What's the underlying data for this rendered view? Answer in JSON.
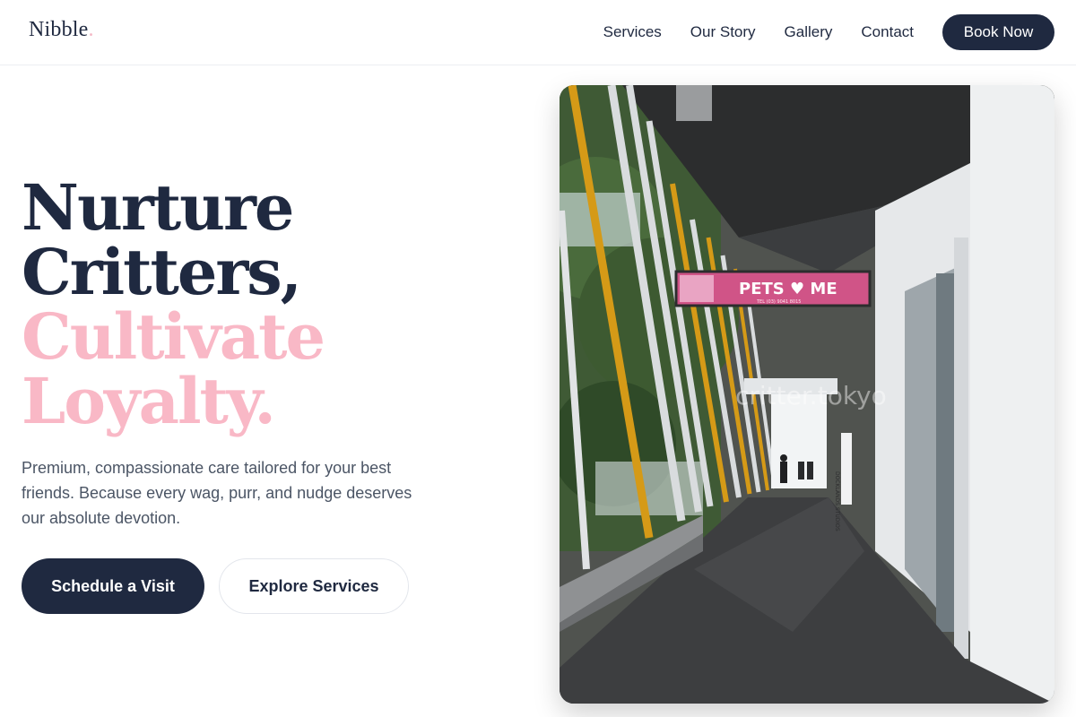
{
  "header": {
    "logo": "Nibble",
    "logo_dot": ".",
    "nav": [
      "Services",
      "Our Story",
      "Gallery",
      "Contact"
    ],
    "cta": "Book Now"
  },
  "hero": {
    "headline": [
      "Nurture",
      "Critters,",
      "Cultivate",
      "Loyalty."
    ],
    "subtitle": "Premium, compassionate care tailored for your best friends. Because every wag, purr, and nudge deserves our absolute devotion.",
    "primary_button": "Schedule a Visit",
    "secondary_button": "Explore Services",
    "image": {
      "sign_text": "PETS ♥ ME",
      "sign_phone": "TEL (03) 9041 8015",
      "side_sign": "DOCKLANDS STUDIOS",
      "watermark": "critter.tokyo"
    }
  },
  "colors": {
    "navy": "#1f2940",
    "pink": "#f9b8c6",
    "muted_text": "#4b5565"
  }
}
